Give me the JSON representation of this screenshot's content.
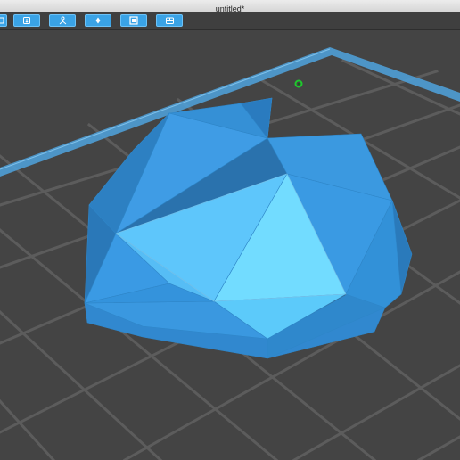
{
  "window": {
    "title": "untitled*"
  },
  "toolbar": {
    "buttons": [
      {
        "name": "toolbar-button-1",
        "icon": "panel-icon"
      },
      {
        "name": "toolbar-button-2",
        "icon": "import-icon"
      },
      {
        "name": "toolbar-button-3",
        "icon": "supports-icon"
      },
      {
        "name": "toolbar-button-4",
        "icon": "print-profile-icon"
      },
      {
        "name": "toolbar-button-5",
        "icon": "slice-icon"
      },
      {
        "name": "toolbar-button-6",
        "icon": "export-icon"
      }
    ]
  },
  "viewport": {
    "background_color": "#444444",
    "grid_color": "#5c5c5c",
    "plate_edge_color": "#4f9fd6",
    "model_color": "#3d9ae6",
    "origin_marker_color": "#1ec92c"
  }
}
